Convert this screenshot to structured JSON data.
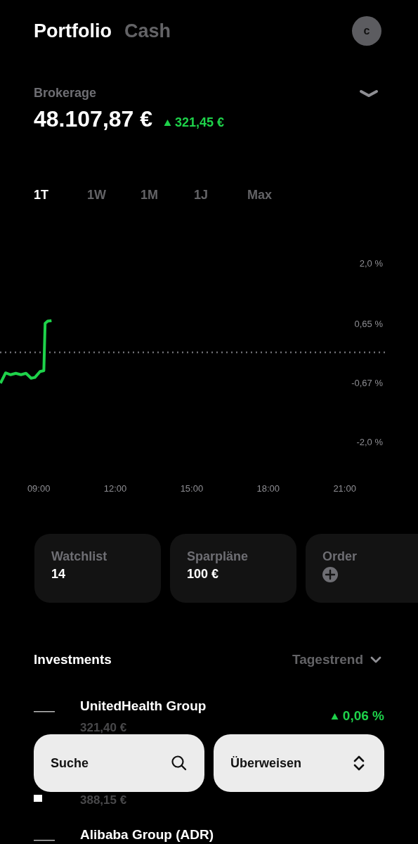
{
  "header": {
    "tabs": [
      {
        "label": "Portfolio",
        "selected": true
      },
      {
        "label": "Cash",
        "selected": false
      }
    ],
    "avatar": "c"
  },
  "account": {
    "name": "Brokerage",
    "value": "48.107,87 €",
    "change": "321,45 €",
    "rising": true
  },
  "periods": [
    {
      "label": "1T",
      "selected": true
    },
    {
      "label": "1W",
      "selected": false
    },
    {
      "label": "1M",
      "selected": false
    },
    {
      "label": "1J",
      "selected": false
    },
    {
      "label": "Max",
      "selected": false
    }
  ],
  "chart": {
    "chart_data": {
      "type": "line",
      "xlim": [
        7.48,
        22.58
      ],
      "ylim": [
        -2.0,
        2.0
      ],
      "xticks": [
        {
          "value": 9,
          "label": "09:00"
        },
        {
          "value": 12,
          "label": "12:00"
        },
        {
          "value": 15,
          "label": "15:00"
        },
        {
          "value": 18,
          "label": "18:00"
        },
        {
          "value": 21,
          "label": "21:00"
        }
      ],
      "yticks": [
        {
          "value": 2.0,
          "label": "2,0 %"
        },
        {
          "value": 0.65,
          "label": "0,65 %"
        },
        {
          "value": -0.67,
          "label": "-0,67 %"
        },
        {
          "value": -2.0,
          "label": "-2,0 %"
        }
      ],
      "ref_lines": [
        {
          "axis": "y",
          "value": 0
        }
      ],
      "x": [
        7.5,
        7.7,
        7.9,
        8.1,
        8.3,
        8.5,
        8.7,
        8.85,
        9.05,
        9.2,
        9.25,
        9.35,
        9.5
      ],
      "series": [
        {
          "color": "#1ed24a",
          "values": [
            -0.69,
            -0.46,
            -0.5,
            -0.47,
            -0.5,
            -0.47,
            -0.58,
            -0.56,
            -0.43,
            -0.41,
            0.65,
            0.7,
            0.71
          ]
        }
      ]
    }
  },
  "cards": [
    {
      "kind": "value",
      "label": "Watchlist",
      "value": "14"
    },
    {
      "kind": "value",
      "label": "Sparpläne",
      "value": "100 €"
    },
    {
      "kind": "add",
      "label": "Order"
    }
  ],
  "investments": {
    "title": "Investments",
    "sort": "Tagestrend",
    "rows": [
      {
        "name": "UnitedHealth Group",
        "price": "321,40 €",
        "change": "0,06 %",
        "rising": true
      },
      {
        "price": "388,15 €"
      },
      {
        "name": "Alibaba Group (ADR)"
      }
    ]
  },
  "actions": [
    {
      "kind": "search",
      "label": "Suche"
    },
    {
      "kind": "transfer",
      "label": "Überweisen"
    }
  ]
}
